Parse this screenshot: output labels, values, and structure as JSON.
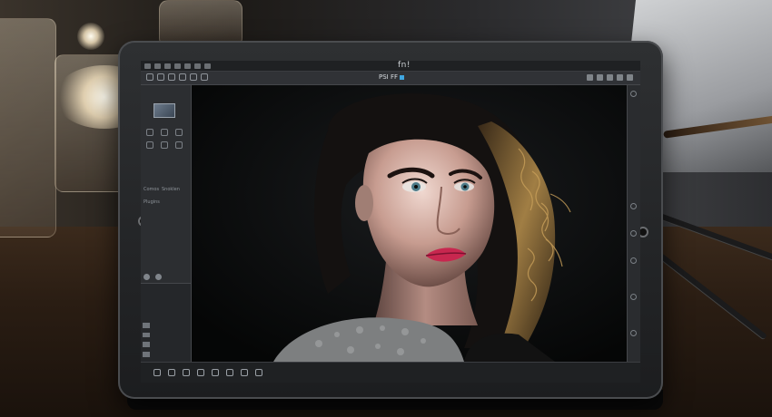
{
  "app": {
    "title": "fn!",
    "document_tab": "PSI FF"
  },
  "icons": {
    "menubar": [
      "menu-icon",
      "menu-icon",
      "menu-icon",
      "menu-icon",
      "menu-icon",
      "menu-icon",
      "menu-icon",
      "menu-icon",
      "menu-icon"
    ],
    "toolbar_left": [
      "move-icon",
      "select-icon",
      "crop-icon",
      "brush-icon",
      "eraser-icon",
      "text-icon",
      "zoom-icon"
    ],
    "toolbar_right": [
      "minimize-icon",
      "maximize-icon",
      "close-icon",
      "settings-icon",
      "layers-icon"
    ],
    "left_tools": [
      "lasso-icon",
      "wand-icon",
      "clone-icon",
      "heal-icon",
      "blur-icon",
      "dodge-icon"
    ],
    "status_bar": [
      "record-icon",
      "play-icon",
      "triangle-icon",
      "brush-icon",
      "edit-icon",
      "flag-icon",
      "shape-icon",
      "square-icon"
    ]
  },
  "left_panel": {
    "label_1": "Comos",
    "label_2": "Snoklen",
    "label_3": "Plugins"
  },
  "colors": {
    "accent": "#3fa6e0",
    "lips": "#c8274f",
    "ui_dark": "#27292c"
  }
}
